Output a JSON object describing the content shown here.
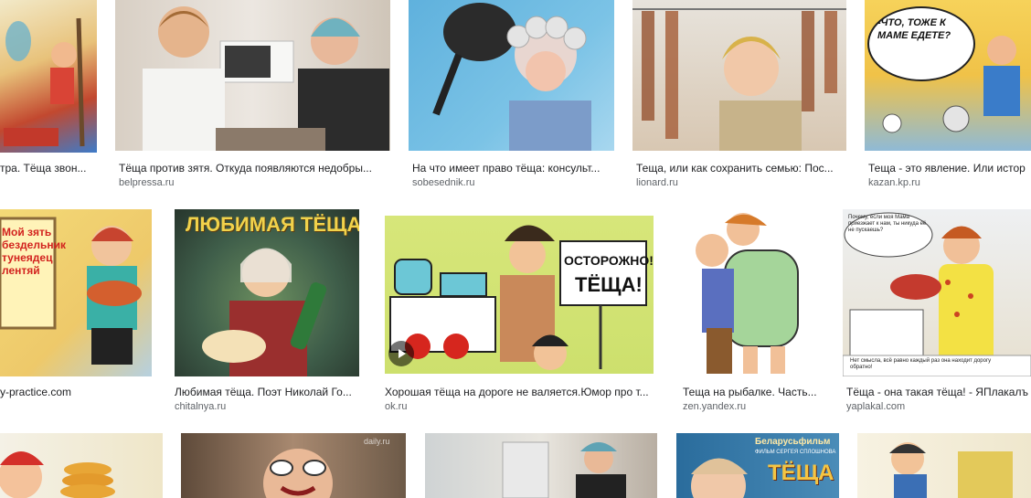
{
  "results": {
    "row1": [
      {
        "caption": "тра. Тёща звон...",
        "source": ""
      },
      {
        "caption": "Тёща против зятя. Откуда появляются недобры...",
        "source": "belpressa.ru"
      },
      {
        "caption": "На что имеет право тёща: консульт...",
        "source": "sobesednik.ru"
      },
      {
        "caption": "Теща, или как сохранить семью: Пос...",
        "source": "lionard.ru"
      },
      {
        "caption": "Теща - это явление. Или истор",
        "source": "kazan.kp.ru"
      }
    ],
    "row2": [
      {
        "caption": "",
        "source": "y-practice.com"
      },
      {
        "caption": "Любимая тёща. Поэт Николай Го...",
        "source": "chitalnya.ru"
      },
      {
        "caption": "Хорошая тёща на дороге не валяется.Юмор про т...",
        "source": "ok.ru"
      },
      {
        "caption": "Теща на рыбалке. Часть...",
        "source": "zen.yandex.ru"
      },
      {
        "caption": "Тёща - она такая тёща! - ЯПлакалъ",
        "source": "yaplakal.com"
      }
    ],
    "row3": [
      {
        "caption": "",
        "source": ""
      },
      {
        "caption": "",
        "source": ""
      },
      {
        "caption": "",
        "source": ""
      },
      {
        "caption": "",
        "source": ""
      },
      {
        "caption": "",
        "source": ""
      }
    ]
  },
  "image_text": {
    "kazan_bubble": "-ЧТО, ТОЖЕ К МАМЕ ЕДЕТЕ?",
    "chitalnya_title": "ЛЮБИМАЯ ТЁЩА",
    "okru_sign_line1": "ОСТОРОЖНО!",
    "okru_sign_line2": "ТЁЩА!",
    "practice_sign": "Мой зять бездельник тунеядец лентяй",
    "yaplakal_top": "Почему, если моя Мама приезжает к нам, ты никуда её не пускаешь?",
    "yaplakal_bottom": "Нет смысла, всё равно каждый раз она находит дорогу обратно!",
    "belarusfilm_line1": "Беларусьфильм",
    "belarusfilm_line2": "ФИЛЬМ СЕРГЕЯ СПЛОШНОВА",
    "belarusfilm_title": "ТЁЩА",
    "daily_watermark": "daily.ru"
  },
  "icons": {
    "video_badge": "play-icon"
  },
  "colors": {
    "caption": "#202124",
    "source": "#5f6368",
    "background": "#ffffff"
  }
}
